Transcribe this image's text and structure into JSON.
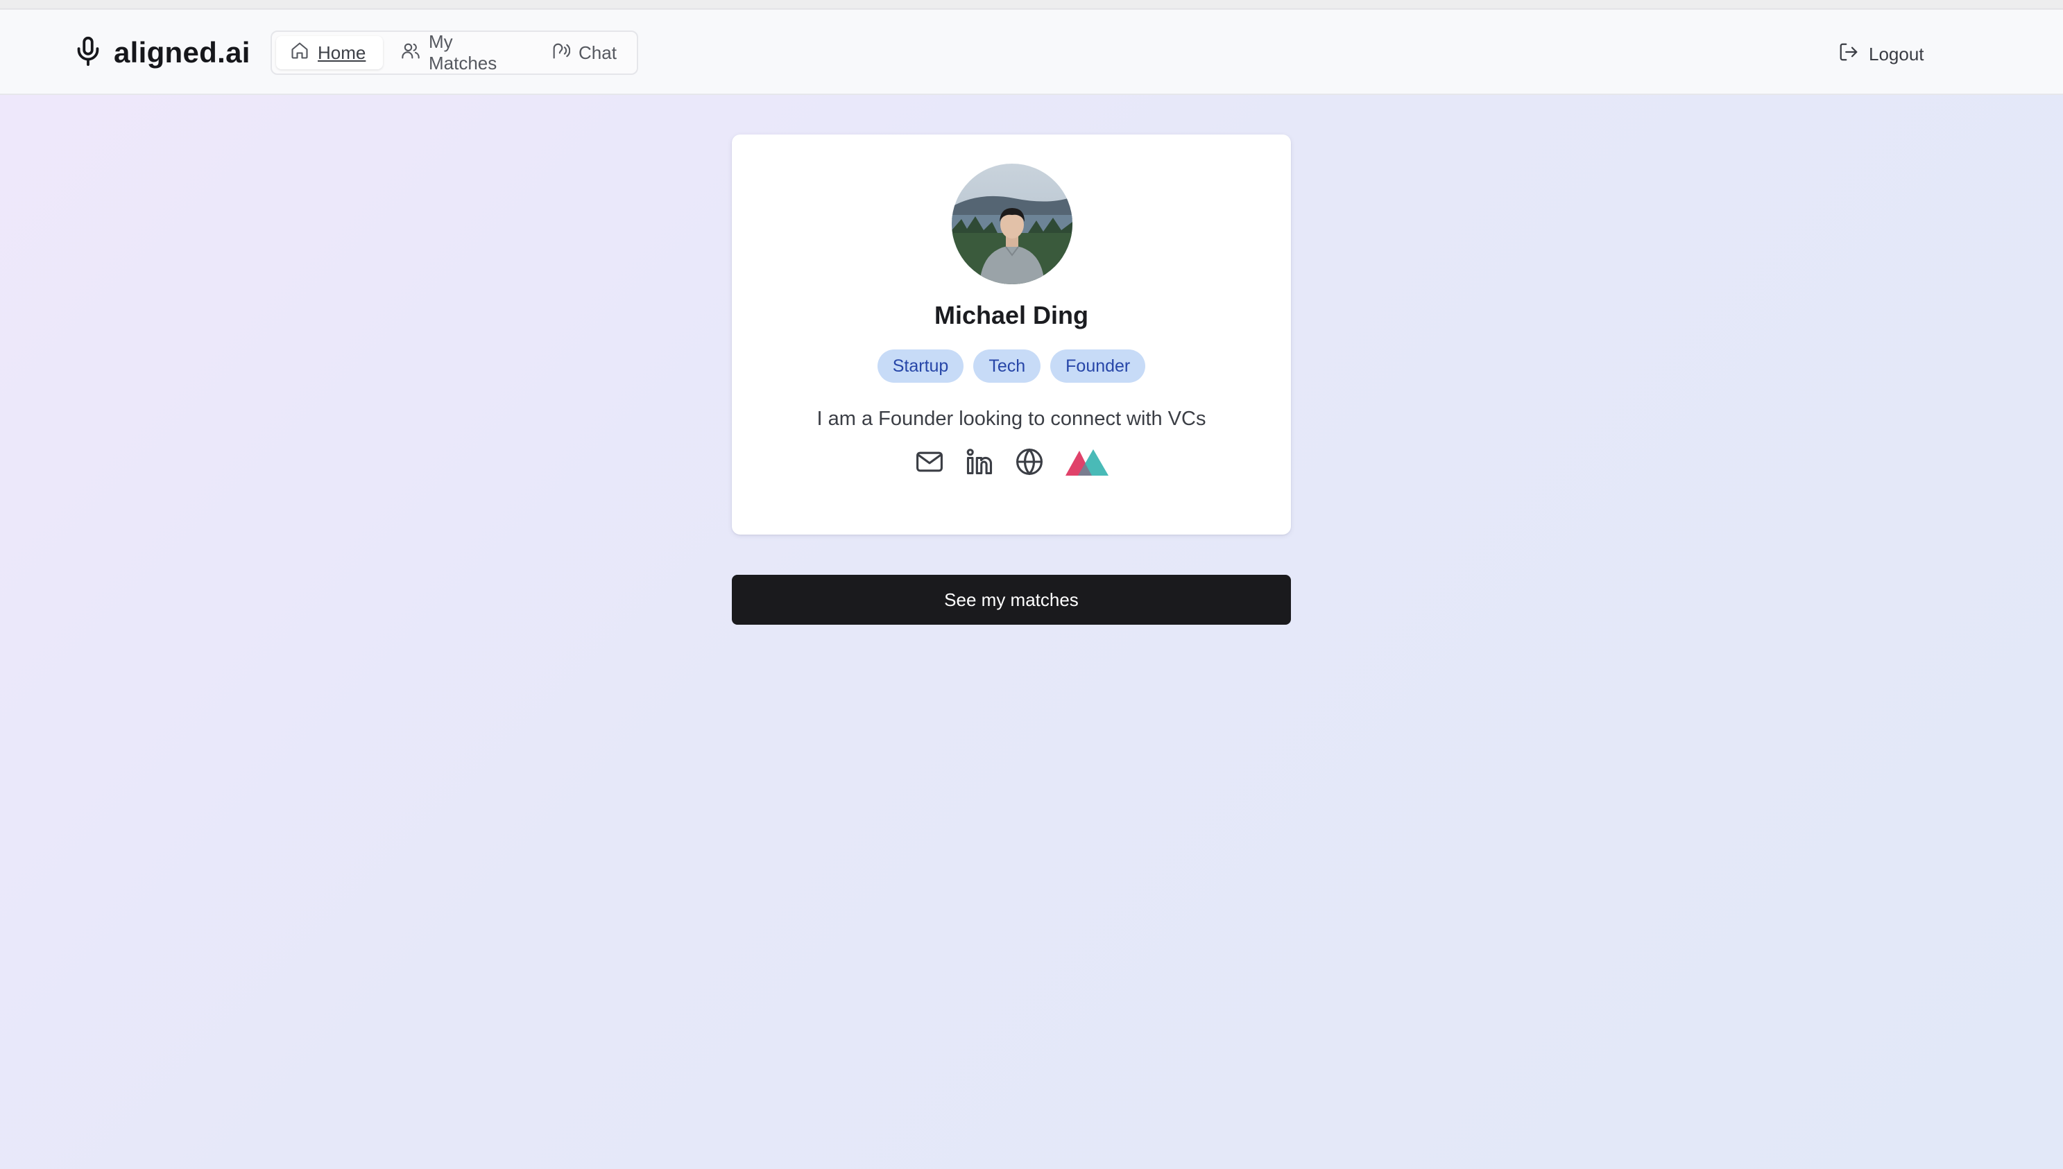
{
  "app": {
    "brand": "aligned.ai"
  },
  "nav": {
    "items": [
      {
        "label": "Home",
        "icon": "home-icon",
        "active": true
      },
      {
        "label": "My Matches",
        "icon": "users-icon",
        "active": false
      },
      {
        "label": "Chat",
        "icon": "speech-icon",
        "active": false
      }
    ],
    "logout_label": "Logout"
  },
  "profile": {
    "name": "Michael Ding",
    "tags": [
      "Startup",
      "Tech",
      "Founder"
    ],
    "bio": "I am a Founder looking to connect with VCs",
    "links": [
      "mail-icon",
      "linkedin-icon",
      "globe-icon",
      "brand-logo-icon"
    ]
  },
  "cta": {
    "label": "See my matches"
  },
  "colors": {
    "tag_bg": "#c7dbf7",
    "tag_text": "#2746a8",
    "cta_bg": "#1a1a1d",
    "logo_pink": "#e0426a",
    "logo_teal": "#3fb6b3"
  }
}
